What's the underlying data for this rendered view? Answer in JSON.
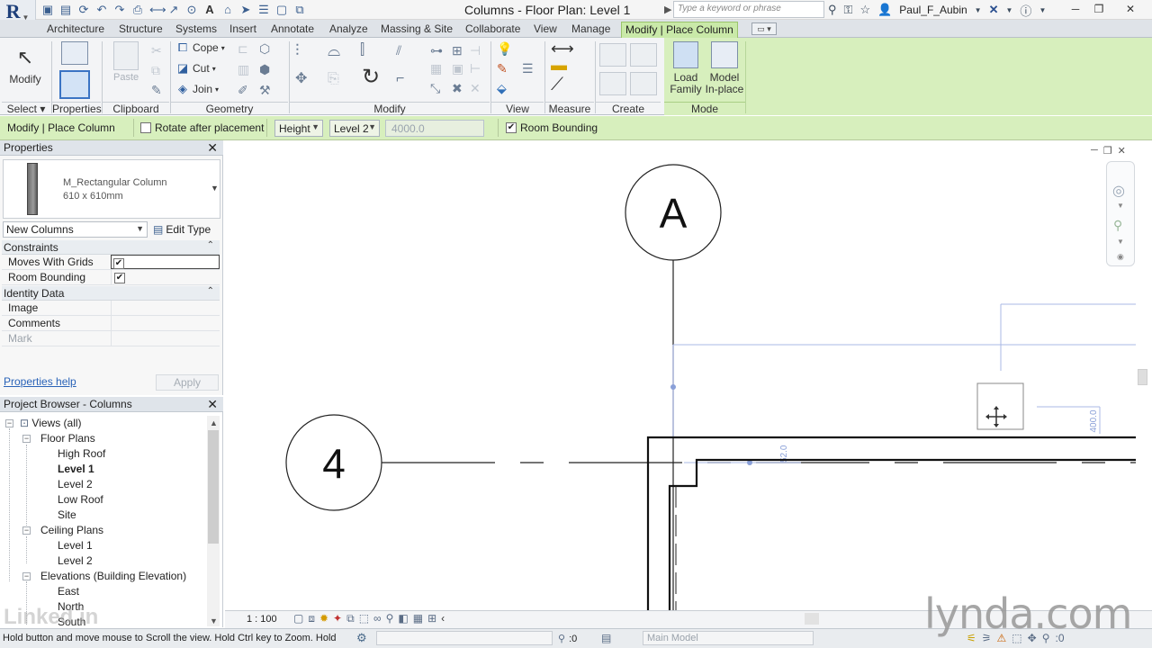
{
  "window": {
    "title": "Columns - Floor Plan: Level 1",
    "search_placeholder": "Type a keyword or phrase",
    "user": "Paul_F_Aubin"
  },
  "ribbon_tabs": [
    "Architecture",
    "Structure",
    "Systems",
    "Insert",
    "Annotate",
    "Analyze",
    "Massing & Site",
    "Collaborate",
    "View",
    "Manage",
    "Modify | Place Column"
  ],
  "ribbon": {
    "modify_label": "Modify",
    "properties_label": "Properties",
    "paste_label": "Paste",
    "cope_label": "Cope",
    "cut_label": "Cut",
    "join_label": "Join",
    "load_family_label": "Load Family",
    "model_inplace_label": "Model In-place",
    "panels": [
      "Select",
      "Properties",
      "Clipboard",
      "Geometry",
      "Modify",
      "View",
      "Measure",
      "Create",
      "Mode"
    ]
  },
  "options_bar": {
    "context": "Modify | Place Column",
    "rotate_label": "Rotate after placement",
    "height_value": "Height",
    "level_value": "Level 2",
    "depth_value": "4000.0",
    "room_bounding_label": "Room Bounding"
  },
  "properties": {
    "title": "Properties",
    "family": "M_Rectangular Column",
    "type": "610 x 610mm",
    "instance_filter": "New Columns",
    "edit_type": "Edit Type",
    "groups": {
      "constraints": "Constraints",
      "identity": "Identity Data"
    },
    "rows": {
      "moves_with_grids": "Moves With Grids",
      "room_bounding": "Room Bounding",
      "image": "Image",
      "comments": "Comments",
      "mark": "Mark"
    },
    "help_link": "Properties help",
    "apply": "Apply"
  },
  "browser": {
    "title": "Project Browser - Columns",
    "views_all": "Views (all)",
    "floor_plans": "Floor Plans",
    "fp_items": [
      "High Roof",
      "Level 1",
      "Level 2",
      "Low Roof",
      "Site"
    ],
    "ceiling_plans": "Ceiling Plans",
    "cp_items": [
      "Level 1",
      "Level 2"
    ],
    "elevations": "Elevations (Building Elevation)",
    "el_items": [
      "East",
      "North",
      "South"
    ]
  },
  "canvas": {
    "grid_a": "A",
    "grid_4": "4",
    "dim_vertical": "400.0",
    "dim_small": "52.0"
  },
  "view_bar": {
    "scale": "1 : 100"
  },
  "status": {
    "message": "Hold button and move mouse to Scroll the view. Hold Ctrl key to Zoom. Hold",
    "zero": ":0",
    "model": "Main Model",
    "filter_count": ":0"
  },
  "watermarks": {
    "lynda": "lynda.com",
    "linkedin": "Linked in"
  },
  "colors": {
    "ribbon_context": "#d7efbd",
    "accent_blue": "#2a63b8",
    "dim_blue": "#8aa0d8"
  }
}
